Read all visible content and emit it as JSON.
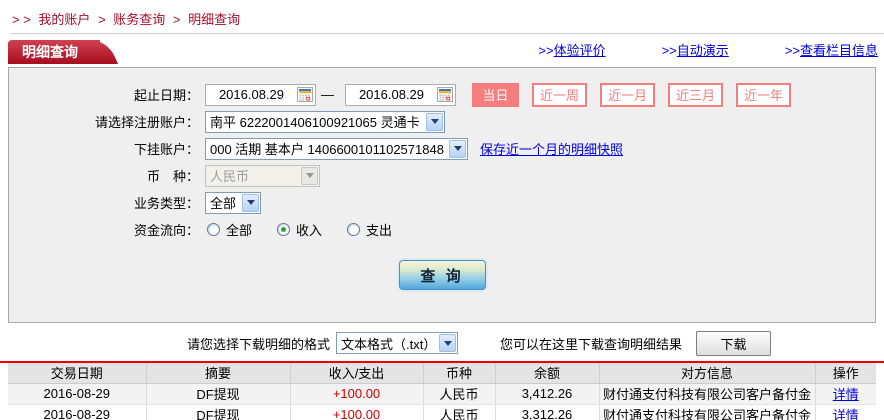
{
  "colors": {
    "breadcrumb_red": "#a50e28",
    "tab_red": "#a60d1f",
    "quick_button_red": "#f57d7d",
    "link_blue": "#0000dd",
    "amount_red": "#cc0000",
    "divider_red": "#ee0000",
    "query_button_blue": "#51a8da"
  },
  "breadcrumb": {
    "prefix": "> >",
    "separator": ">",
    "items": [
      "我的账户",
      "账务查询",
      "明细查询"
    ]
  },
  "tab": {
    "label": "明细查询"
  },
  "header_links": {
    "prefix": ">>",
    "items": [
      {
        "label": "体验评价"
      },
      {
        "label": "自动演示"
      },
      {
        "label": "查看栏目信息"
      }
    ]
  },
  "form": {
    "date_range": {
      "label": "起止日期：",
      "start": "2016.08.29",
      "end": "2016.08.29",
      "dash": "—"
    },
    "quick_buttons": [
      {
        "label": "当日",
        "active": true
      },
      {
        "label": "近一周",
        "active": false
      },
      {
        "label": "近一月",
        "active": false
      },
      {
        "label": "近三月",
        "active": false
      },
      {
        "label": "近一年",
        "active": false
      }
    ],
    "register_account": {
      "label": "请选择注册账户：",
      "value": "南平 6222001406100921065 灵通卡"
    },
    "sub_account": {
      "label": "下挂账户：",
      "value": "000 活期 基本户 1406600101102571848",
      "snapshot_link": "保存近一个月的明细快照"
    },
    "currency": {
      "label": "币　种：",
      "value": "人民币",
      "disabled": true
    },
    "business_type": {
      "label": "业务类型：",
      "value": "全部"
    },
    "fund_flow": {
      "label": "资金流向：",
      "options": [
        {
          "label": "全部",
          "checked": false
        },
        {
          "label": "收入",
          "checked": true
        },
        {
          "label": "支出",
          "checked": false
        }
      ]
    },
    "query_button_label": "查 询"
  },
  "download": {
    "format_label": "请您选择下载明细的格式",
    "format_value": "文本格式（.txt）",
    "hint": "您可以在这里下载查询明细结果",
    "button_label": "下载"
  },
  "table": {
    "headers": [
      "交易日期",
      "摘要",
      "收入/支出",
      "币种",
      "余额",
      "对方信息",
      "操作"
    ],
    "rows": [
      {
        "date": "2016-08-29",
        "summary": "DF提现",
        "amount": "+100.00",
        "currency": "人民币",
        "balance": "3,412.26",
        "counterparty": "财付通支付科技有限公司客户备付金",
        "action": "详情"
      },
      {
        "date": "2016-08-29",
        "summary": "DF提现",
        "amount": "+100.00",
        "currency": "人民币",
        "balance": "3,312.26",
        "counterparty": "财付通支付科技有限公司客户备付金",
        "action": "详情"
      }
    ]
  }
}
